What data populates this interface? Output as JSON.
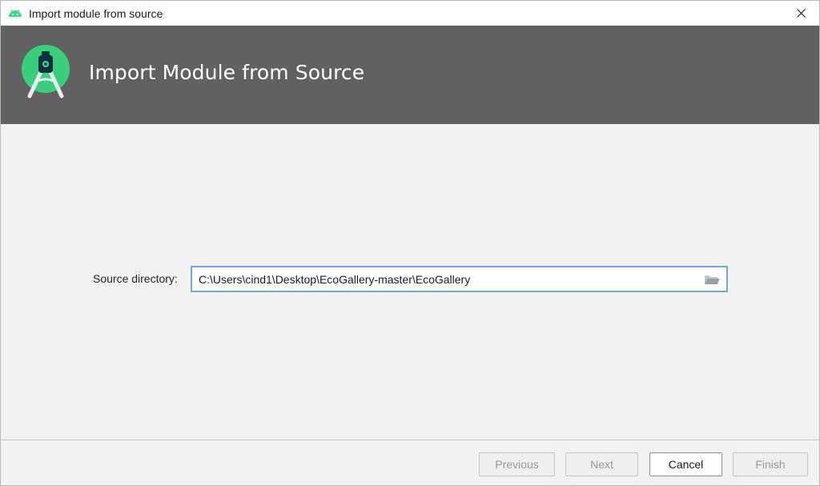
{
  "window": {
    "title": "Import module from source",
    "app_icon": "android-icon",
    "close_icon": "close-icon"
  },
  "banner": {
    "logo": "android-studio-logo",
    "heading": "Import Module from Source"
  },
  "form": {
    "source_label": "Source directory:",
    "source_value": "C:\\Users\\cind1\\Desktop\\EcoGallery-master\\EcoGallery",
    "browse_icon": "folder-icon"
  },
  "footer": {
    "previous_label": "Previous",
    "next_label": "Next",
    "cancel_label": "Cancel",
    "finish_label": "Finish"
  },
  "colors": {
    "banner_bg": "#616161",
    "android_green": "#3ddc84",
    "focus_border": "#6fa6e8"
  }
}
